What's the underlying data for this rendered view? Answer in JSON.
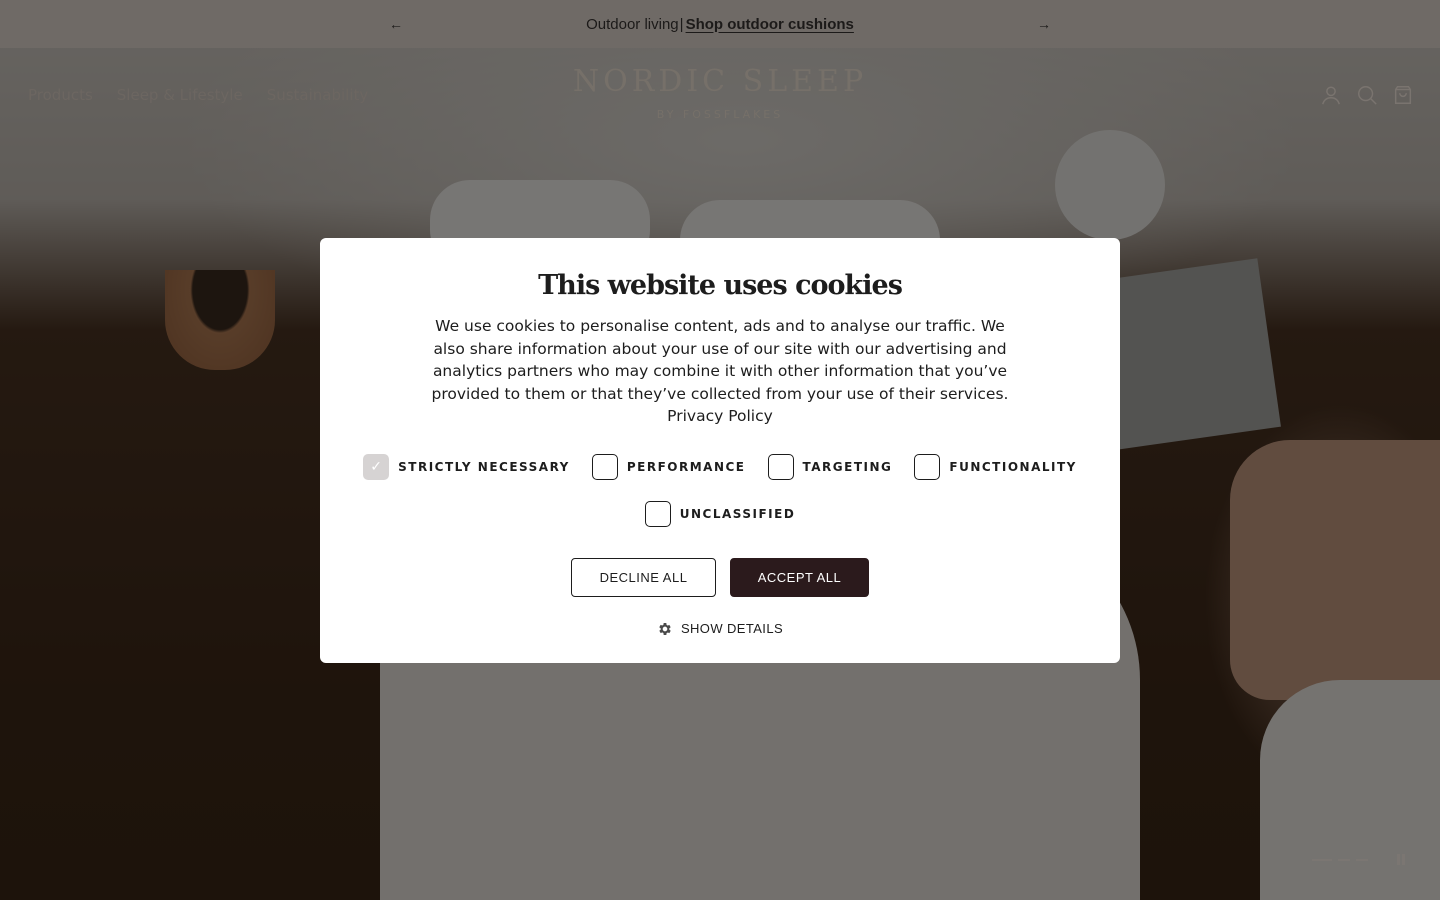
{
  "announcement": {
    "text": "Outdoor living",
    "separator": "|",
    "link_label": "Shop outdoor cushions",
    "prev_icon": "arrow-left-icon",
    "next_icon": "arrow-right-icon"
  },
  "header": {
    "nav": [
      {
        "label": "Products"
      },
      {
        "label": "Sleep & Lifestyle"
      },
      {
        "label": "Sustainability"
      }
    ],
    "logo": {
      "main": "NORDIC SLEEP",
      "sub": "BY FOSSFLAKES"
    },
    "icons": [
      "account-icon",
      "search-icon",
      "cart-icon"
    ]
  },
  "cookie_modal": {
    "title": "This website uses cookies",
    "body": "We use cookies to personalise content, ads and to analyse our traffic. We also share information about your use of our site with our advertising and analytics partners who may combine it with other information that you’ve provided to them or that they’ve collected from your use of their services.",
    "privacy_link": "Privacy Policy",
    "categories": [
      {
        "label": "STRICTLY NECESSARY",
        "checked": true
      },
      {
        "label": "PERFORMANCE",
        "checked": false
      },
      {
        "label": "TARGETING",
        "checked": false
      },
      {
        "label": "FUNCTIONALITY",
        "checked": false
      },
      {
        "label": "UNCLASSIFIED",
        "checked": false
      }
    ],
    "decline_label": "DECLINE ALL",
    "accept_label": "ACCEPT ALL",
    "show_details_label": "SHOW DETAILS",
    "accent_color": "#2b1a1c"
  },
  "slider": {
    "slide_count": 3,
    "active_slide": 1,
    "pause_icon": "pause-icon"
  }
}
